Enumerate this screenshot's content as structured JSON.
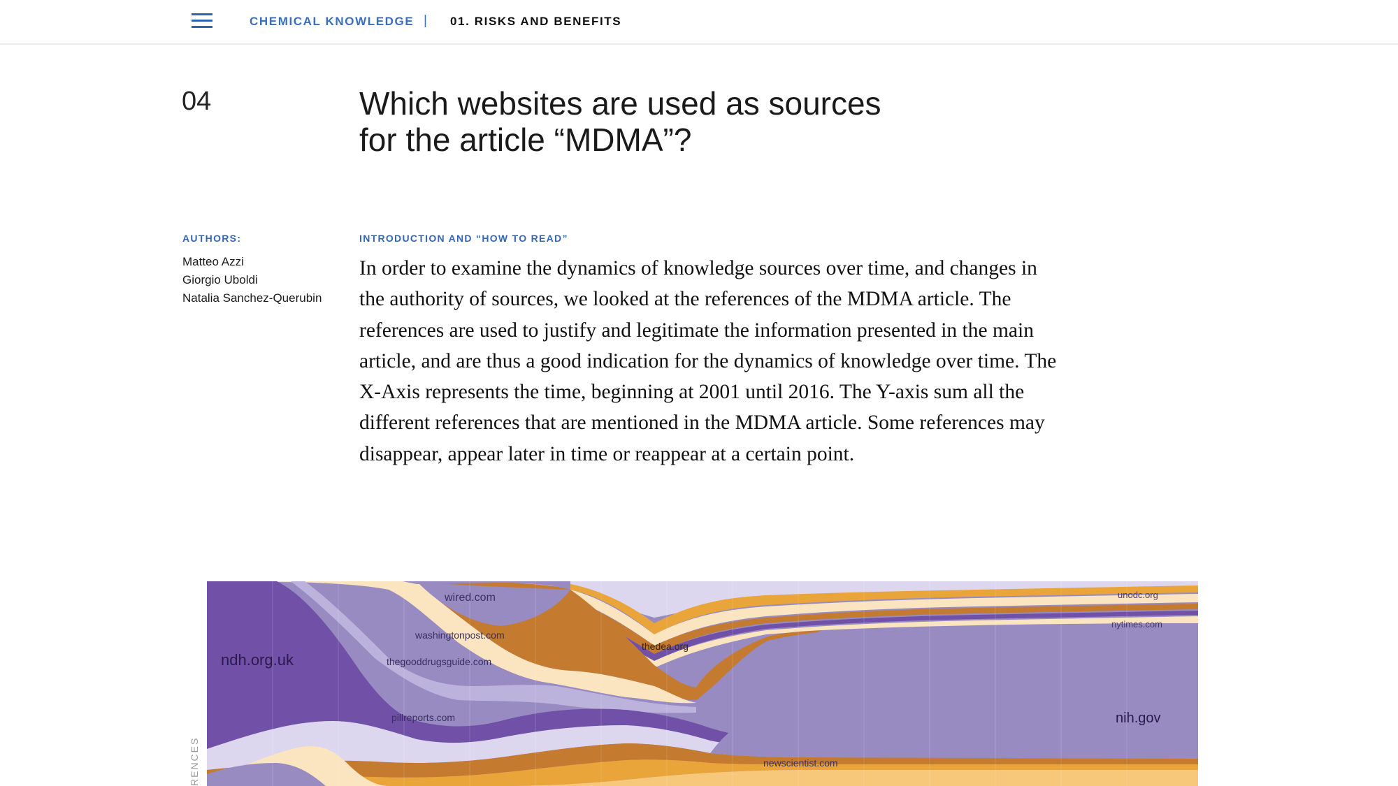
{
  "nav": {
    "menu_icon": "hamburger-menu-icon",
    "primary": "CHEMICAL KNOWLEDGE",
    "separator": "|",
    "current": "01. RISKS AND BENEFITS"
  },
  "section": {
    "number": "04",
    "title_line1": "Which websites are used as sources",
    "title_line2": "for the article “MDMA”?"
  },
  "authors": {
    "label": "AUTHORS:",
    "names": [
      "Matteo Azzi",
      "Giorgio Uboldi",
      "Natalia Sanchez-Querubin"
    ]
  },
  "intro": {
    "label": "INTRODUCTION AND “HOW TO READ”",
    "text": "In order to examine the dynamics of knowledge sources over time, and changes in the authority of sources, we looked at the references of the MDMA article. The references are used to justify and legitimate the information presented in the main article, and are thus a good indication for the dynamics of knowledge over time. The X-Axis represents the time, beginning at 2001 until 2016. The Y-axis sum all the different references that are mentioned in the MDMA article. Some references may disappear, appear later in time or reappear at a certain point."
  },
  "chart": {
    "y_axis_label_visible": "RENCES",
    "colors": {
      "purple_dark": "#7150a8",
      "purple_mid": "#978bc2",
      "lavender": "#bbb3dc",
      "lavender_light": "#dcd7ee",
      "cream": "#fbe4c0",
      "orange": "#e9a43a",
      "brown": "#c47a2f",
      "light_orange": "#f7c77a"
    },
    "labels": [
      "ndh.org.uk",
      "wired.com",
      "washingtonpost.com",
      "thegooddrugsguide.com",
      "pillreports.com",
      "thedea.org",
      "unodc.org",
      "nytimes.com",
      "nih.gov",
      "newscientist.com"
    ]
  },
  "chart_data": {
    "type": "area",
    "title": "",
    "xlabel": "",
    "ylabel": "",
    "x_range": [
      2001,
      2016
    ],
    "series": [
      {
        "name": "ndh.org.uk"
      },
      {
        "name": "wired.com"
      },
      {
        "name": "washingtonpost.com"
      },
      {
        "name": "thegooddrugsguide.com"
      },
      {
        "name": "pillreports.com"
      },
      {
        "name": "thedea.org"
      },
      {
        "name": "unodc.org"
      },
      {
        "name": "nytimes.com"
      },
      {
        "name": "nih.gov"
      },
      {
        "name": "newscientist.com"
      }
    ]
  }
}
